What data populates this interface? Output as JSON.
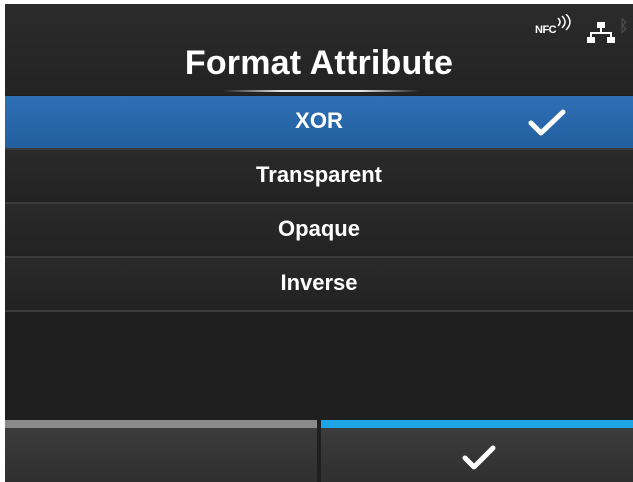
{
  "header": {
    "title": "Format Attribute",
    "status_icons": {
      "nfc_label": "NFC",
      "network_icon": "network-icon",
      "bluetooth_icon": "bluetooth-icon"
    }
  },
  "options": [
    {
      "label": "XOR",
      "selected": true
    },
    {
      "label": "Transparent",
      "selected": false
    },
    {
      "label": "Opaque",
      "selected": false
    },
    {
      "label": "Inverse",
      "selected": false
    }
  ],
  "footer": {
    "left_button_icon": "",
    "right_button_icon": "checkmark-icon"
  },
  "colors": {
    "selected_row": "#2466a8",
    "accent_confirm": "#1ea5e6",
    "accent_inactive": "#8a8a8a",
    "background": "#1f1f1f"
  }
}
